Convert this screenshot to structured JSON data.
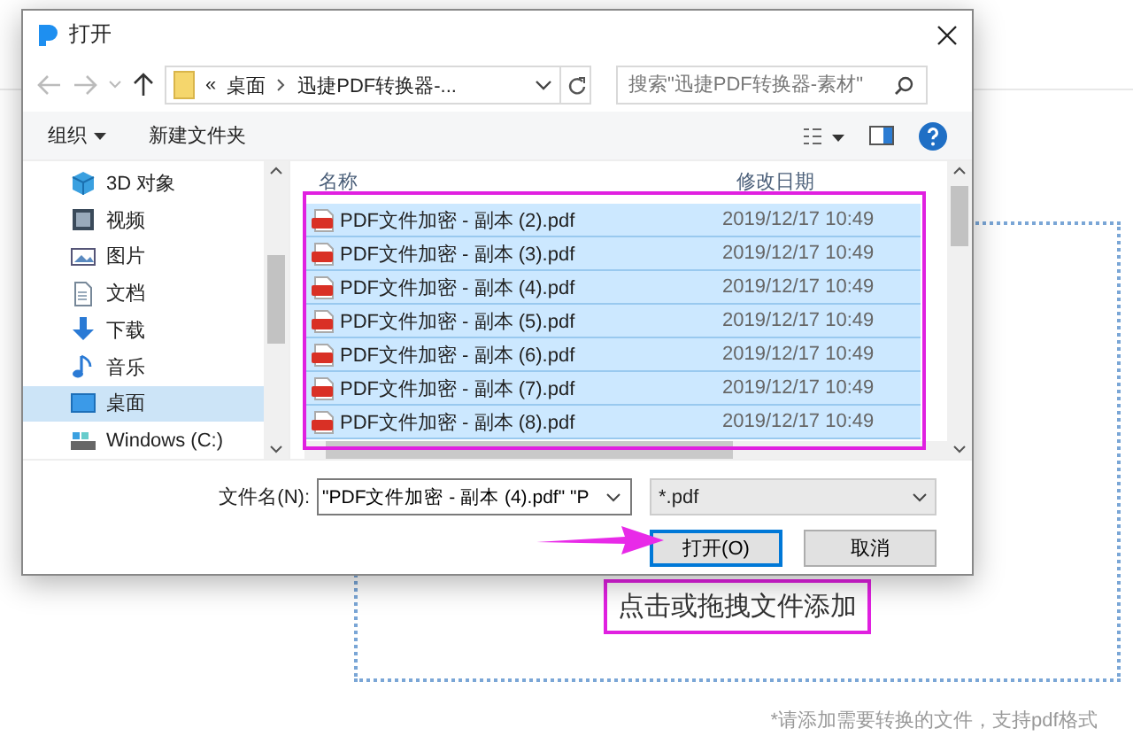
{
  "window": {
    "title": "打开"
  },
  "nav": {
    "overflow": "«",
    "path": [
      "桌面",
      "迅捷PDF转换器-..."
    ],
    "search": {
      "placeholder": "搜索\"迅捷PDF转换器-素材\""
    }
  },
  "toolbar": {
    "organize": "组织",
    "new_folder": "新建文件夹"
  },
  "sidebar": {
    "items": [
      {
        "label": "3D 对象",
        "kind": "objects",
        "selected": false
      },
      {
        "label": "视频",
        "kind": "video",
        "selected": false
      },
      {
        "label": "图片",
        "kind": "pictures",
        "selected": false
      },
      {
        "label": "文档",
        "kind": "documents",
        "selected": false
      },
      {
        "label": "下载",
        "kind": "downloads",
        "selected": false
      },
      {
        "label": "音乐",
        "kind": "music",
        "selected": false
      },
      {
        "label": "桌面",
        "kind": "desktop",
        "selected": true
      },
      {
        "label": "Windows (C:)",
        "kind": "drive",
        "selected": false
      }
    ]
  },
  "file_list": {
    "columns": [
      "名称",
      "修改日期"
    ],
    "rows": [
      {
        "name": "PDF文件加密 - 副本 (2).pdf",
        "modified": "2019/12/17 10:49",
        "selected": true
      },
      {
        "name": "PDF文件加密 - 副本 (3).pdf",
        "modified": "2019/12/17 10:49",
        "selected": true
      },
      {
        "name": "PDF文件加密 - 副本 (4).pdf",
        "modified": "2019/12/17 10:49",
        "selected": true
      },
      {
        "name": "PDF文件加密 - 副本 (5).pdf",
        "modified": "2019/12/17 10:49",
        "selected": true
      },
      {
        "name": "PDF文件加密 - 副本 (6).pdf",
        "modified": "2019/12/17 10:49",
        "selected": true
      },
      {
        "name": "PDF文件加密 - 副本 (7).pdf",
        "modified": "2019/12/17 10:49",
        "selected": true
      },
      {
        "name": "PDF文件加密 - 副本 (8).pdf",
        "modified": "2019/12/17 10:49",
        "selected": true
      }
    ]
  },
  "filename": {
    "label": "文件名(N):",
    "value": "\"PDF文件加密 - 副本 (4).pdf\" \"P"
  },
  "filetype": {
    "value": "*.pdf"
  },
  "buttons": [
    {
      "label": "打开(O)",
      "kind": "primary"
    },
    {
      "label": "取消",
      "kind": "default"
    }
  ],
  "drop_zone": {
    "label": "点击或拖拽文件添加",
    "hint": "*请添加需要转换的文件，支持pdf格式"
  }
}
